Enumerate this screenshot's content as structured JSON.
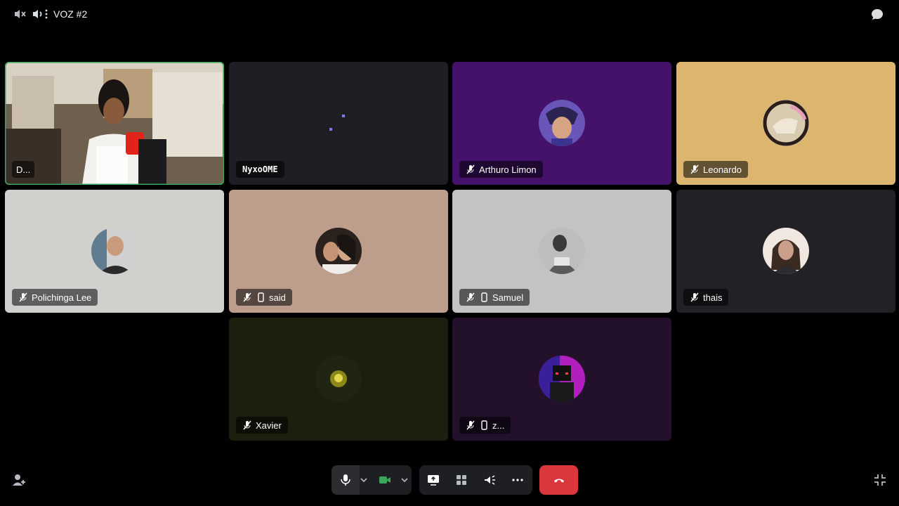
{
  "header": {
    "channel_title": "VOZ #2"
  },
  "tiles": [
    {
      "name": "D...",
      "bg": "#3b3026",
      "speaking": true,
      "has_video": true
    },
    {
      "name": "NyxoOME",
      "bg": "#1e1e24"
    },
    {
      "name": "Arthuro Limon",
      "bg": "#44116b",
      "muted": true
    },
    {
      "name": "Leonardo",
      "bg": "#dcb56e",
      "muted": true
    },
    {
      "name": "Polichinga Lee",
      "bg": "#d2d0cd",
      "muted": true
    },
    {
      "name": "said",
      "bg": "#bd9e8d",
      "muted": true,
      "mobile": true
    },
    {
      "name": "Samuel",
      "bg": "#c3c3c3",
      "muted": true,
      "mobile": true
    },
    {
      "name": "thais",
      "bg": "#222126",
      "muted": true
    },
    {
      "name": "Xavier",
      "bg": "#1c1f0e",
      "muted": true
    },
    {
      "name": "z...",
      "bg": "#23102a",
      "muted": true,
      "mobile": true
    }
  ],
  "colors": {
    "hangup": "#da373c",
    "speaking_border": "#3ba55c",
    "camera_on": "#3ba55c"
  },
  "icons": [
    "speaker-muted-icon",
    "volume-icon",
    "more-vertical-icon",
    "chat-bubble-icon",
    "add-person-icon",
    "microphone-icon",
    "chevron-down-icon",
    "camera-icon",
    "screen-share-icon",
    "activities-icon",
    "soundboard-icon",
    "more-horizontal-icon",
    "phone-hangup-icon",
    "exit-fullscreen-icon"
  ]
}
